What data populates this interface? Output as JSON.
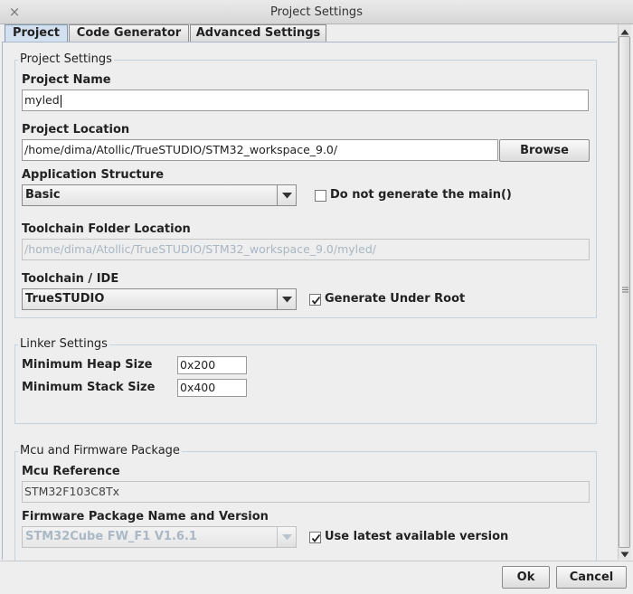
{
  "window": {
    "title": "Project Settings",
    "close_glyph": "×"
  },
  "tabs": [
    {
      "label": "Project"
    },
    {
      "label": "Code Generator"
    },
    {
      "label": "Advanced Settings"
    }
  ],
  "project_settings": {
    "title": "Project Settings",
    "name_label": "Project Name",
    "name_value": "myled",
    "location_label": "Project Location",
    "location_value": "/home/dima/Atollic/TrueSTUDIO/STM32_workspace_9.0/",
    "browse_label": "Browse",
    "app_structure_label": "Application Structure",
    "app_structure_value": "Basic",
    "no_main_label": "Do not generate the main()",
    "toolchain_folder_label": "Toolchain Folder Location",
    "toolchain_folder_value": "/home/dima/Atollic/TrueSTUDIO/STM32_workspace_9.0/myled/",
    "toolchain_ide_label": "Toolchain / IDE",
    "toolchain_ide_value": "TrueSTUDIO",
    "gen_root_label": "Generate Under Root"
  },
  "linker": {
    "title": "Linker Settings",
    "heap_label": "Minimum Heap Size",
    "heap_value": "0x200",
    "stack_label": "Minimum Stack Size",
    "stack_value": "0x400"
  },
  "mcu": {
    "title": "Mcu and Firmware Package",
    "ref_label": "Mcu Reference",
    "ref_value": "STM32F103C8Tx",
    "fw_label": "Firmware Package Name and Version",
    "fw_value": "STM32Cube FW_F1 V1.6.1",
    "latest_label": "Use latest available version"
  },
  "footer": {
    "ok_label": "Ok",
    "cancel_label": "Cancel"
  }
}
